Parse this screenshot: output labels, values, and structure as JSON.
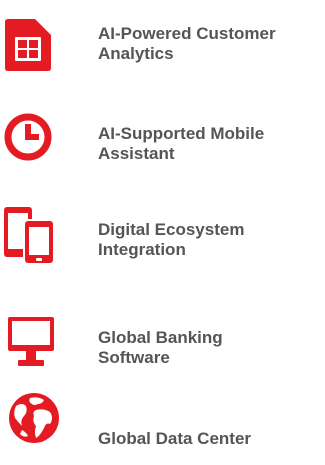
{
  "accent_color": "#e51b24",
  "text_color": "#555555",
  "features": [
    {
      "icon": "sim-card-icon",
      "label": "AI-Powered Customer\nAnalytics"
    },
    {
      "icon": "clock-icon",
      "label": "AI-Supported Mobile\nAssistant"
    },
    {
      "icon": "devices-icon",
      "label": "Digital Ecosystem\nIntegration"
    },
    {
      "icon": "monitor-icon",
      "label": "Global Banking\nSoftware"
    },
    {
      "icon": "globe-icon",
      "label": "Global Data Center"
    }
  ]
}
